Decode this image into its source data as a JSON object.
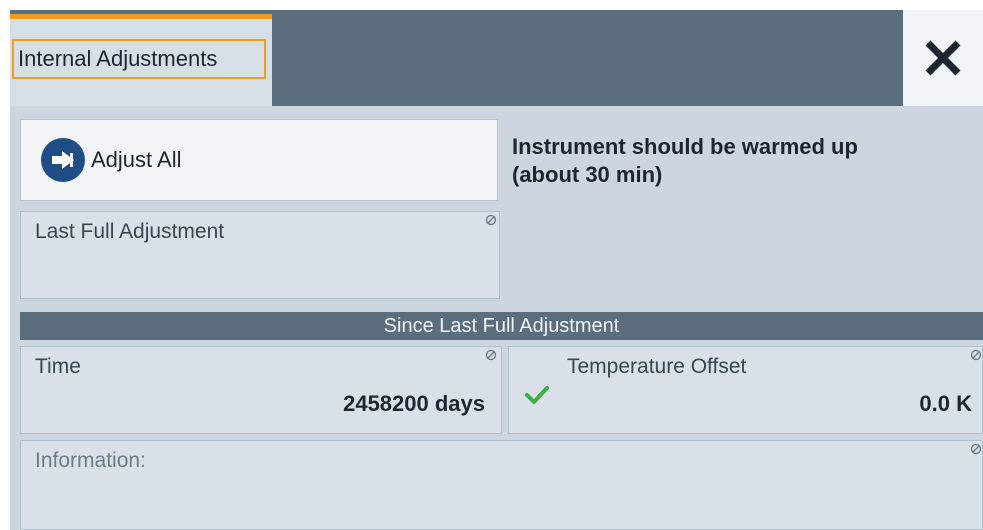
{
  "tab": {
    "label": "Internal Adjustments"
  },
  "actions": {
    "adjust_all_label": "Adjust All"
  },
  "notes": {
    "warmup_line1": "Instrument should be warmed up",
    "warmup_line2": "(about 30 min)"
  },
  "last_full_adjustment": {
    "label": "Last Full Adjustment",
    "value": ""
  },
  "section": {
    "title": "Since Last Full Adjustment"
  },
  "time": {
    "label": "Time",
    "value": "2458200 days"
  },
  "temperature_offset": {
    "label": "Temperature Offset",
    "value": "0.0 K",
    "status_icon": "check-icon"
  },
  "information": {
    "label": "Information:",
    "value": ""
  },
  "colors": {
    "accent": "#f39c1c",
    "header": "#5b6e7e",
    "panel": "#cdd6de",
    "ok_green": "#3cb043",
    "button_icon": "#1f4e86"
  }
}
